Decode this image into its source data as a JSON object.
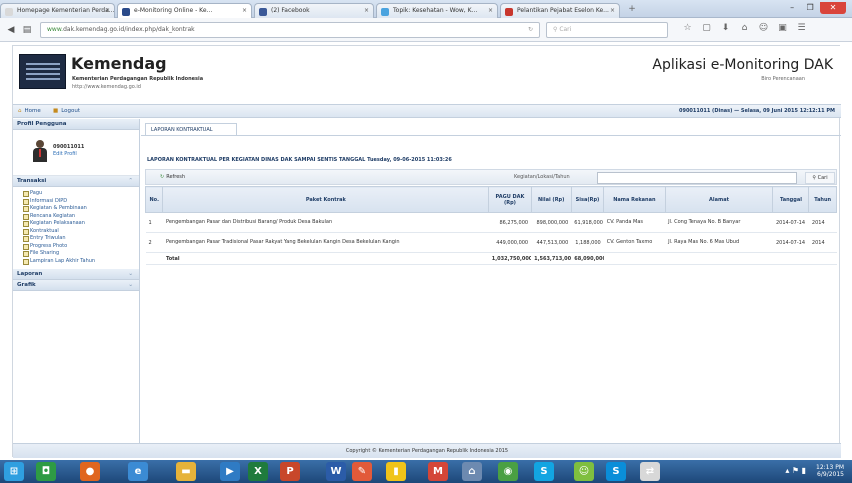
{
  "browser": {
    "tabs": [
      {
        "label": "Homepage Kementerian Perda...",
        "icon": "page-icon",
        "color": "#d9d9d9",
        "active": false
      },
      {
        "label": "e-Monitoring Online - Ke...",
        "icon": "monitor-icon",
        "color": "#2a4a8a",
        "active": true
      },
      {
        "label": "(2) Facebook",
        "icon": "facebook-icon",
        "color": "#3b5998",
        "active": false
      },
      {
        "label": "Topik: Kesehatan - Wow, K...",
        "icon": "globe-icon",
        "color": "#4aa3df",
        "active": false
      },
      {
        "label": "Pelantikan Pejabat Eselon Ke...",
        "icon": "news-icon",
        "color": "#c8372d",
        "active": false
      }
    ],
    "url": "dak.kemendag.go.id/index.php/dak_kontrak",
    "url_green": "www.",
    "search_placeholder": "Cari",
    "window_controls": [
      "–",
      "❐",
      "✕"
    ],
    "toolbar_icons": [
      "☆",
      "▢",
      "⬇",
      "⌂",
      "☺",
      "▣",
      "☰"
    ]
  },
  "header": {
    "brand": "Kemendag",
    "brand_sub": "Kementerian Perdagangan Republik Indonesia",
    "brand_url": "http://www.kemendag.go.id",
    "app_title": "Aplikasi e-Monitoring DAK",
    "app_sub": "Biro Perencanaan"
  },
  "menubar": {
    "home": "Home",
    "logout": "Logout",
    "user_info": "090011011 (Dinas) — Selasa, 09 Juni 2015 12:12:11 PM"
  },
  "sidebar": {
    "profile_title": "Profil Pengguna",
    "user_name": "090011011",
    "edit_profile": "Edit Profil",
    "section_transaksi": "Transaksi",
    "items": [
      {
        "label": "Pagu"
      },
      {
        "label": "Informasi DIPD"
      },
      {
        "label": "Kegiatan & Pembinaan"
      },
      {
        "label": "Rencana Kegiatan"
      },
      {
        "label": "Kegiatan Pelaksanaan"
      },
      {
        "label": "Kontraktual"
      },
      {
        "label": "Entry Triwulan"
      },
      {
        "label": "Progress Photo"
      },
      {
        "label": "File Sharing"
      },
      {
        "label": "Lampiran Lap Akhir Tahun"
      }
    ],
    "section_laporan": "Laporan",
    "section_grafik": "Grafik"
  },
  "main": {
    "tab_label": "LAPORAN KONTRAKTUAL",
    "report_title": "LAPORAN KONTRAKTUAL PER KEGIATAN DINAS DAK SAMPAI SENTIS TANGGAL Tuesday, 09-06-2015 11:03:26",
    "refresh_label": "Refresh",
    "search_label": "Kegiatan/Lokasi/Tahun",
    "search_value": "",
    "search_button": "Cari",
    "columns": [
      "No.",
      "Paket Kontrak",
      "PAGU DAK (Rp)",
      "Nilai (Rp)",
      "Sisa(Rp)",
      "Nama Rekanan",
      "Alamat",
      "Tanggal",
      "Tahun"
    ],
    "rows": [
      {
        "no": "1",
        "paket": "Pengembangan Pasar dan Distribusi Barang/ Produk Desa Bakulan",
        "pagu": "86,275,000",
        "nilai": "898,000,000",
        "sisa": "61,918,000",
        "rekanan": "CV. Panda Mas",
        "alamat": "Jl. Cong Tenaya No. B Banyar",
        "tanggal": "2014-07-14",
        "tahun": "2014"
      },
      {
        "no": "2",
        "paket": "Pengembangan Pasar Tradisional Pasar Rakyat Yang Bekelulan Kangin Desa Bekelulan Kangin",
        "pagu": "449,000,000",
        "nilai": "447,513,000",
        "sisa": "1,188,000",
        "rekanan": "CV. Genton Taxmo",
        "alamat": "Jl. Raya Mas No. 6 Mas Ubud",
        "tanggal": "2014-07-14",
        "tahun": "2014"
      }
    ],
    "total_label": "Total",
    "total": {
      "pagu": "1,032,750,000",
      "nilai": "1,563,713,000",
      "sisa": "68,090,000"
    }
  },
  "footer": "Copyright © Kementerian Perdagangan Republik Indonesia 2015",
  "taskbar": {
    "apps": [
      {
        "icon": "windows-start-icon",
        "color": "#2f9fe0",
        "glyph": "⊞"
      },
      {
        "icon": "app-green-icon",
        "color": "#2e9b44",
        "glyph": "◘"
      },
      {
        "icon": "firefox-icon",
        "color": "#e0661f",
        "glyph": "●"
      },
      {
        "icon": "ie-icon",
        "color": "#3b8bd4",
        "glyph": "e"
      },
      {
        "icon": "explorer-icon",
        "color": "#e6b33a",
        "glyph": "▬"
      },
      {
        "icon": "media-icon",
        "color": "#2f7bc4",
        "glyph": "▶"
      },
      {
        "icon": "excel-icon",
        "color": "#1f7b3d",
        "glyph": "X"
      },
      {
        "icon": "powerpoint-icon",
        "color": "#c8472a",
        "glyph": "P"
      },
      {
        "icon": "word-icon",
        "color": "#2b5ca8",
        "glyph": "W"
      },
      {
        "icon": "paint-icon",
        "color": "#e25a3a",
        "glyph": "✎"
      },
      {
        "icon": "bookmark-icon",
        "color": "#f0c419",
        "glyph": "▮"
      },
      {
        "icon": "gmail-icon",
        "color": "#d44638",
        "glyph": "M"
      },
      {
        "icon": "task-icon",
        "color": "#6d8ab0",
        "glyph": "⌂"
      },
      {
        "icon": "chrome-icon",
        "color": "#4aa043",
        "glyph": "◉"
      },
      {
        "icon": "skype-icon",
        "color": "#12a5e2",
        "glyph": "S"
      },
      {
        "icon": "chat-icon",
        "color": "#7fbf3f",
        "glyph": "☺"
      },
      {
        "icon": "skype2-icon",
        "color": "#0a8ed9",
        "glyph": "S"
      },
      {
        "icon": "network-icon",
        "color": "#d8d8d8",
        "glyph": "⇄"
      }
    ],
    "clock_time": "12:13 PM",
    "clock_date": "6/9/2015"
  }
}
